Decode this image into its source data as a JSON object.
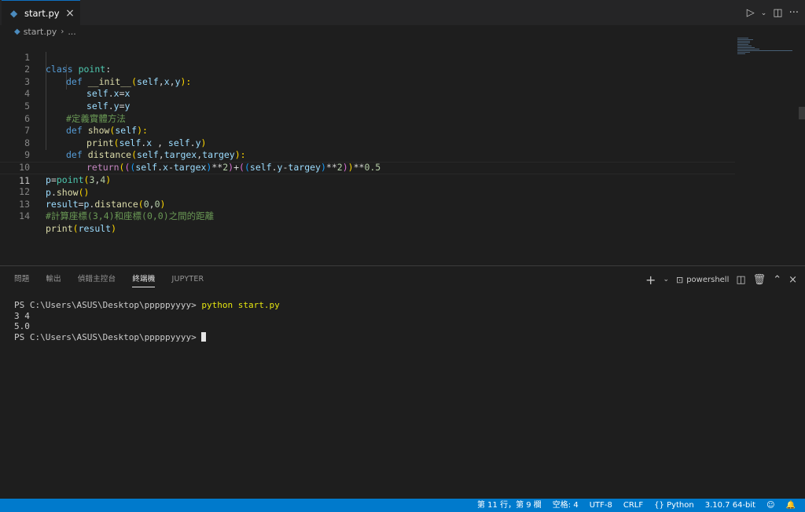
{
  "tab": {
    "filename": "start.py",
    "language_icon": "python-icon"
  },
  "breadcrumb": {
    "file": "start.py",
    "more": "..."
  },
  "code_lines": [
    {
      "n": "1"
    },
    {
      "n": "2"
    },
    {
      "n": "3"
    },
    {
      "n": "4"
    },
    {
      "n": "5"
    },
    {
      "n": "6"
    },
    {
      "n": "7"
    },
    {
      "n": "8"
    },
    {
      "n": "9"
    },
    {
      "n": "10"
    },
    {
      "n": "11"
    },
    {
      "n": "12"
    },
    {
      "n": "13"
    },
    {
      "n": "14"
    }
  ],
  "code": {
    "l1": [
      "class",
      " ",
      "point",
      ":"
    ],
    "l2": [
      "def",
      " ",
      "__init__",
      "(",
      "self",
      ",",
      "x",
      ",",
      "y",
      "):"
    ],
    "l3": [
      "self",
      ".",
      "x",
      "=",
      "x"
    ],
    "l4": [
      "self",
      ".",
      "y",
      "=",
      "y"
    ],
    "l5": "#定義實體方法",
    "l6": [
      "def",
      " ",
      "show",
      "(",
      "self",
      "):"
    ],
    "l7": [
      "print",
      "(",
      "self",
      ".",
      "x",
      " , ",
      "self",
      ".",
      "y",
      ")"
    ],
    "l8": [
      "def",
      " ",
      "distance",
      "(",
      "self",
      ",",
      "targex",
      ",",
      "targey",
      "):"
    ],
    "l9": [
      "return",
      "(",
      "(",
      "(",
      "self",
      ".",
      "x",
      "-",
      "targex",
      ")",
      "**",
      "2",
      ")",
      "+",
      "(",
      "(",
      "self",
      ".",
      "y",
      "-",
      "targey",
      ")",
      "**",
      "2",
      ")",
      ")",
      "**",
      "0.5"
    ],
    "l10": [
      "p",
      "=",
      "point",
      "(",
      "3",
      ",",
      "4",
      ")"
    ],
    "l11": [
      "p",
      ".",
      "show",
      "()"
    ],
    "l12": [
      "result",
      "=",
      "p",
      ".",
      "distance",
      "(",
      "0",
      ",",
      "0",
      ")"
    ],
    "l13": "#計算座標(3,4)和座標(0,0)之間的距離",
    "l14": [
      "print",
      "(",
      "result",
      ")"
    ]
  },
  "panel": {
    "tabs": [
      "問題",
      "輸出",
      "偵錯主控台",
      "終端機",
      "JUPYTER"
    ],
    "active_tab": "終端機",
    "shell_label": "powershell"
  },
  "terminal": {
    "prompt1": "PS C:\\Users\\ASUS\\Desktop\\pppppyyyy> ",
    "command": "python start.py",
    "out1": "3 4",
    "out2": "5.0",
    "prompt2": "PS C:\\Users\\ASUS\\Desktop\\pppppyyyy> "
  },
  "status": {
    "position": "第 11 行，第 9 欄",
    "spaces": "空格: 4",
    "encoding": "UTF-8",
    "eol": "CRLF",
    "language": "Python",
    "interpreter": "3.10.7 64-bit"
  },
  "colors": {
    "accent": "#007acc",
    "editor_bg": "#1e1e1e",
    "keyword": "#569cd6",
    "class": "#4ec9b0",
    "function": "#dcdcaa",
    "comment": "#6a9955"
  }
}
